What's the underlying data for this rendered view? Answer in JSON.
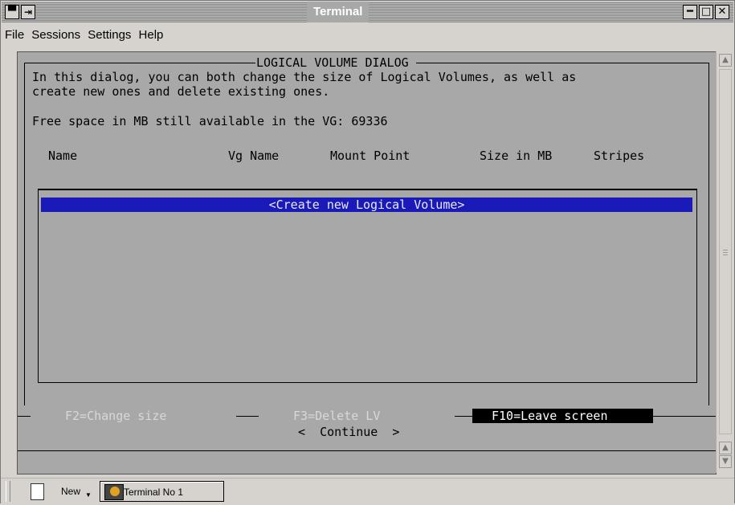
{
  "window": {
    "title": "Terminal",
    "buttons": [
      "minimize-icon",
      "maximize-icon",
      "close-icon"
    ]
  },
  "menu": [
    "File",
    "Sessions",
    "Settings",
    "Help"
  ],
  "dialog": {
    "title": "LOGICAL VOLUME DIALOG",
    "intro_line1": "In this dialog, you can both change the size of Logical Volumes, as well as",
    "intro_line2": "create new ones and delete existing ones.",
    "free_space": "Free space in MB still available in the VG: 69336",
    "columns": [
      "Name",
      "Vg Name",
      "Mount Point",
      "Size in MB",
      "Stripes"
    ],
    "list_items": [
      "<Create new Logical Volume>"
    ],
    "fkeys": {
      "f2": "F2=Change size",
      "f3": "F3=Delete LV",
      "f10": "F10=Leave screen"
    },
    "continue": "<  Continue  >"
  },
  "taskbar": {
    "new_label": "New",
    "tab_label": "Terminal No 1"
  },
  "colors": {
    "terminal_bg": "#a8a8a8",
    "selection": "#1a1ab8",
    "fkey_dim": "#d8d8d8"
  }
}
